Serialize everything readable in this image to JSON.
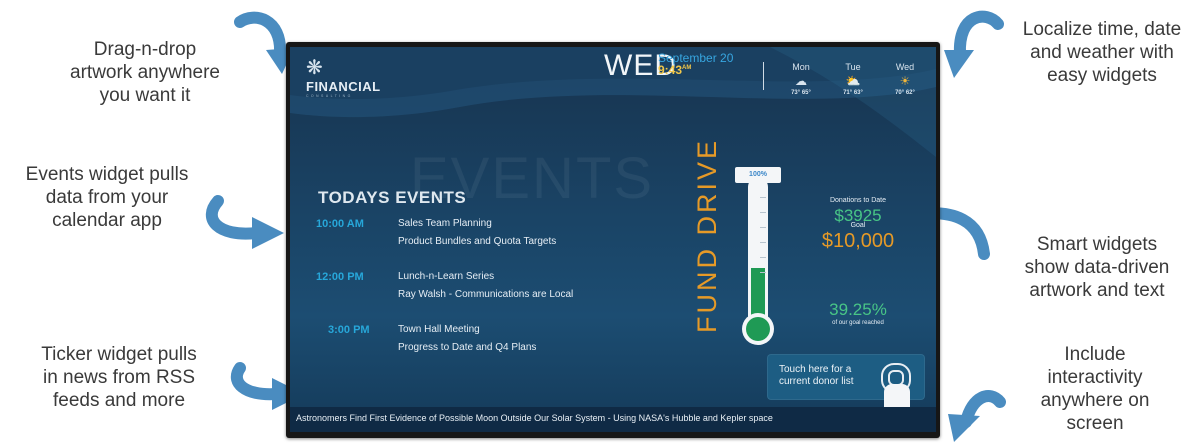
{
  "callouts": {
    "drag": [
      "Drag-n-drop",
      "artwork anywhere",
      "you want it"
    ],
    "localize": [
      "Localize time, date",
      "and weather with",
      "easy widgets"
    ],
    "events": [
      "Events widget pulls",
      "data from your",
      "calendar app"
    ],
    "smart": [
      "Smart widgets",
      "show data-driven",
      "artwork and text"
    ],
    "ticker": [
      "Ticker widget pulls",
      "in news from RSS",
      "feeds and more"
    ],
    "interact": [
      "Include",
      "interactivity",
      "anywhere on",
      "screen"
    ]
  },
  "header": {
    "logo_text": "FINANCIAL",
    "logo_sub": "CONSULTING",
    "day": "WED",
    "date": "September 20",
    "time": "9:43",
    "time_ampm": "AM"
  },
  "weather": [
    {
      "day": "Mon",
      "icon": "cloud-rain-icon",
      "glyph": "☁",
      "temps": "73°  65°"
    },
    {
      "day": "Tue",
      "icon": "partly-cloudy-icon",
      "glyph": "⛅",
      "temps": "71°  63°"
    },
    {
      "day": "Wed",
      "icon": "sun-icon",
      "glyph": "☀",
      "temps": "70°  62°"
    }
  ],
  "events": {
    "title": "TODAYS EVENTS",
    "background_word": "EVENTS",
    "items": [
      {
        "time": "10:00 AM",
        "line1": "Sales Team Planning",
        "line2": "Product Bundles and Quota Targets"
      },
      {
        "time": "12:00 PM",
        "line1": "Lunch-n-Learn Series",
        "line2": "Ray Walsh - Communications are Local"
      },
      {
        "time": "3:00 PM",
        "line1": "Town Hall Meeting",
        "line2": "Progress to Date and Q4 Plans"
      }
    ]
  },
  "fund": {
    "title": "FUND DRIVE",
    "ribbon": "100%",
    "donations_label": "Donations to Date",
    "donations_value": "$3925",
    "goal_label": "Goal",
    "goal_value": "$10,000",
    "pct_value": "39.25%",
    "pct_label": "of our goal reached",
    "fill_fraction": 0.3925
  },
  "touch": {
    "line1": "Touch here for a",
    "line2": "current donor list"
  },
  "ticker": {
    "text": "Astronomers Find First Evidence of Possible Moon Outside Our Solar System - Using NASA's Hubble and Kepler space"
  },
  "colors": {
    "accent_blue": "#27a7d9",
    "accent_orange": "#e69a27",
    "accent_green": "#48c586",
    "arrow_blue": "#4a8cc0"
  }
}
